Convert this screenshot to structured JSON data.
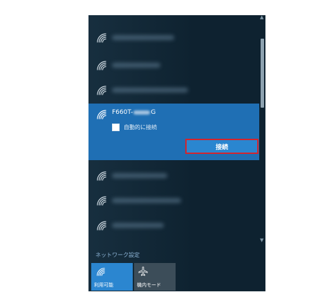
{
  "wifi_panel": {
    "icon": "wifi-signal-icon",
    "selected_network": {
      "name_prefix": "F660T-",
      "name_suffix": "G",
      "auto_connect_label": "自動的に接続",
      "auto_connect_checked": false,
      "connect_label": "接続"
    },
    "network_settings_label": "ネットワーク設定",
    "quick_tiles": [
      {
        "label": "利用可能",
        "icon": "wifi-icon",
        "active": true
      },
      {
        "label": "機内モード",
        "icon": "airplane-icon",
        "active": false
      }
    ]
  },
  "colors": {
    "panel_bg": "#0e2230",
    "selected_bg": "#1f6fb4",
    "highlight_border": "#d4242c",
    "accent": "#2b86d0"
  }
}
